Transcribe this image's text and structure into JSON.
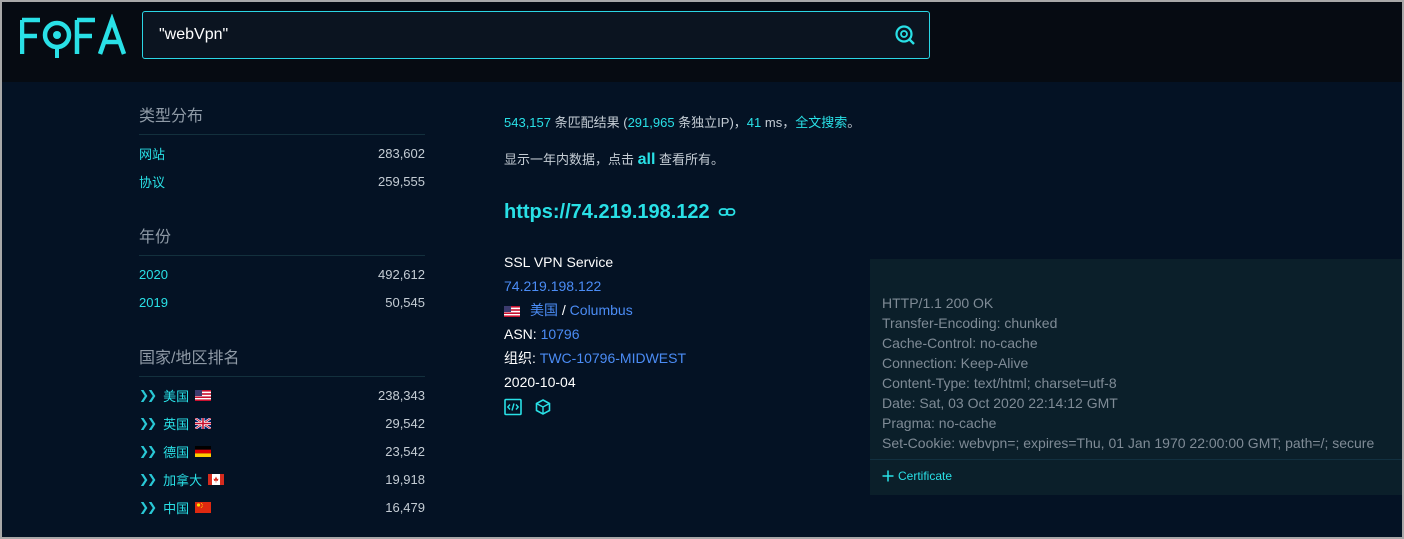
{
  "header": {
    "logo_text": "FOFA",
    "search_value": "\"webVpn\""
  },
  "sidebar": {
    "type_heading": "类型分布",
    "type_items": [
      {
        "label": "网站",
        "count": "283,602"
      },
      {
        "label": "协议",
        "count": "259,555"
      }
    ],
    "year_heading": "年份",
    "year_items": [
      {
        "label": "2020",
        "count": "492,612"
      },
      {
        "label": "2019",
        "count": "50,545"
      }
    ],
    "country_heading": "国家/地区排名",
    "country_items": [
      {
        "label": "美国",
        "count": "238,343",
        "flag": "us-flag"
      },
      {
        "label": "英国",
        "count": "29,542",
        "flag": "uk-flag"
      },
      {
        "label": "德国",
        "count": "23,542",
        "flag": "de-flag"
      },
      {
        "label": "加拿大",
        "count": "19,918",
        "flag": "ca-flag"
      },
      {
        "label": "中国",
        "count": "16,479",
        "flag": "cn-flag"
      }
    ]
  },
  "stats": {
    "total": "543,157",
    "total_suffix": " 条匹配结果 (",
    "unique_ip": "291,965",
    "unique_suffix": " 条独立IP)，",
    "time": "41",
    "time_suffix": " ms，",
    "fulltext": "全文搜索",
    "end": "。"
  },
  "note": {
    "prefix": "显示一年内数据，点击 ",
    "all": "all",
    "suffix": " 查看所有。"
  },
  "result": {
    "url": "https://74.219.198.122",
    "title": "SSL VPN Service",
    "ip": "74.219.198.122",
    "country": "美国",
    "sep": " / ",
    "city": "Columbus",
    "asn_label": "ASN: ",
    "asn": "10796",
    "org_label": "组织: ",
    "org": "TWC-10796-MIDWEST",
    "date": "2020-10-04",
    "headers": "HTTP/1.1 200 OK\nTransfer-Encoding: chunked\nCache-Control: no-cache\nConnection: Keep-Alive\nContent-Type: text/html; charset=utf-8\nDate: Sat, 03 Oct 2020 22:14:12 GMT\nPragma: no-cache\nSet-Cookie: webvpn=; expires=Thu, 01 Jan 1970 22:00:00 GMT; path=/; secure",
    "certificate_label": "Certificate"
  },
  "colors": {
    "accent": "#29e0e6",
    "link": "#4b8cf5",
    "background": "#041224"
  }
}
